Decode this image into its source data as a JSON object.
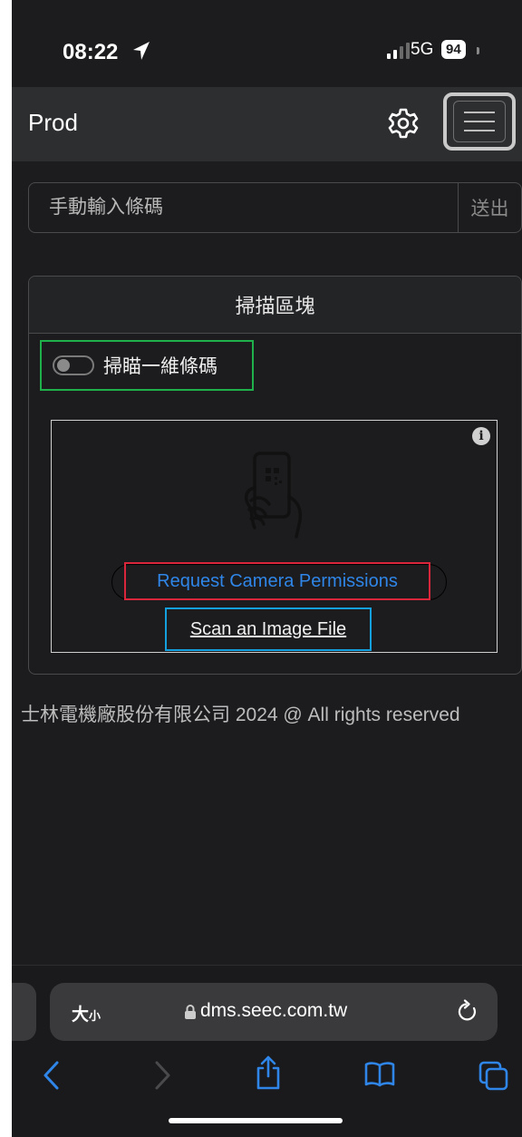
{
  "status_bar": {
    "time": "08:22",
    "network": "5G",
    "battery": "94"
  },
  "navbar": {
    "brand": "Prod"
  },
  "barcode_form": {
    "placeholder": "手動輸入條碼",
    "submit_label": "送出"
  },
  "scan_card": {
    "header": "掃描區塊",
    "switch_label": "掃瞄一維條碼",
    "scanner": {
      "permission_button": "Request Camera Permissions",
      "scan_file_link": "Scan an Image File"
    }
  },
  "footer": {
    "text": "士林電機廠股份有限公司 2024 @ All rights reserved"
  },
  "browser": {
    "text_size_main": "大",
    "text_size_small": "小",
    "url": "dms.seec.com.tw"
  },
  "colors": {
    "background": "#1c1c1e",
    "navbar": "#2c2e30",
    "switch_highlight": "#1fb04c",
    "permission_highlight": "#d9263a",
    "link_blue": "#2f86e8",
    "file_highlight": "#14a0de"
  }
}
